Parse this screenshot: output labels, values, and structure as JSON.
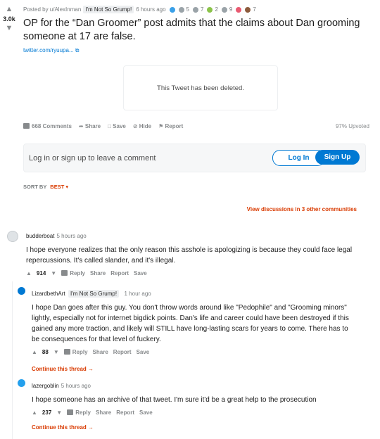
{
  "post": {
    "score": "3.0k",
    "posted_by": "Posted by u/AlexInman",
    "flair": "I'm Not So Grump!",
    "time": "6 hours ago",
    "awards": [
      {
        "name": "award-1-icon",
        "color": "#3aa0e8",
        "count": ""
      },
      {
        "name": "award-2-icon",
        "color": "#9aa3a8",
        "count": "5"
      },
      {
        "name": "award-3-icon",
        "color": "#9aa3a8",
        "count": "7"
      },
      {
        "name": "award-4-icon",
        "color": "#8bc34a",
        "count": "2"
      },
      {
        "name": "award-5-icon",
        "color": "#9aa3a8",
        "count": "9"
      },
      {
        "name": "award-6-icon",
        "color": "#e85a71",
        "count": ""
      },
      {
        "name": "award-7-icon",
        "color": "#8d5b3c",
        "count": "7"
      }
    ],
    "title": "OP for the “Dan Groomer” post admits that the claims about Dan grooming someone at 17 are false.",
    "link": "twitter.com/ryuupa... ⧉",
    "tweet_deleted": "This Tweet has been deleted.",
    "actions": {
      "comments": "668 Comments",
      "share": "Share",
      "save": "Save",
      "hide": "Hide",
      "report": "Report",
      "upvoted": "97% Upvoted"
    }
  },
  "login": {
    "prompt": "Log in or sign up to leave a comment",
    "login_label": "Log In",
    "signup_label": "Sign Up"
  },
  "sort": {
    "label": "SORT BY",
    "value": "BEST ▾"
  },
  "other_discussions": "View discussions in 3 other communities",
  "comments": [
    {
      "author": "budderboat",
      "time": "5 hours ago",
      "body": "I hope everyone realizes that the only reason this asshole is apologizing is because they could face legal repercussions. It's called slander, and it's illegal.",
      "score": "914",
      "reply": "Reply",
      "share": "Share",
      "report": "Report",
      "save": "Save"
    },
    {
      "author": "LizardbethArt",
      "flair": "I'm Not So Grump!",
      "time": "1 hour ago",
      "body": "I hope Dan goes after this guy. You don't throw words around like \"Pedophile\" and \"Grooming minors\" lightly, especially not for internet bigdick points. Dan's life and career could have been destroyed if this gained any more traction, and likely will STILL have long-lasting scars for years to come. There has to be consequences for that level of fuckery.",
      "score": "88",
      "reply": "Reply",
      "share": "Share",
      "report": "Report",
      "save": "Save",
      "continue": "Continue this thread →"
    },
    {
      "author": "lazergoblin",
      "time": "5 hours ago",
      "body": "I hope someone has an archive of that tweet. I'm sure it'd be a great help to the prosecution",
      "score": "237",
      "reply": "Reply",
      "share": "Share",
      "report": "Report",
      "save": "Save",
      "continue": "Continue this thread →"
    }
  ]
}
